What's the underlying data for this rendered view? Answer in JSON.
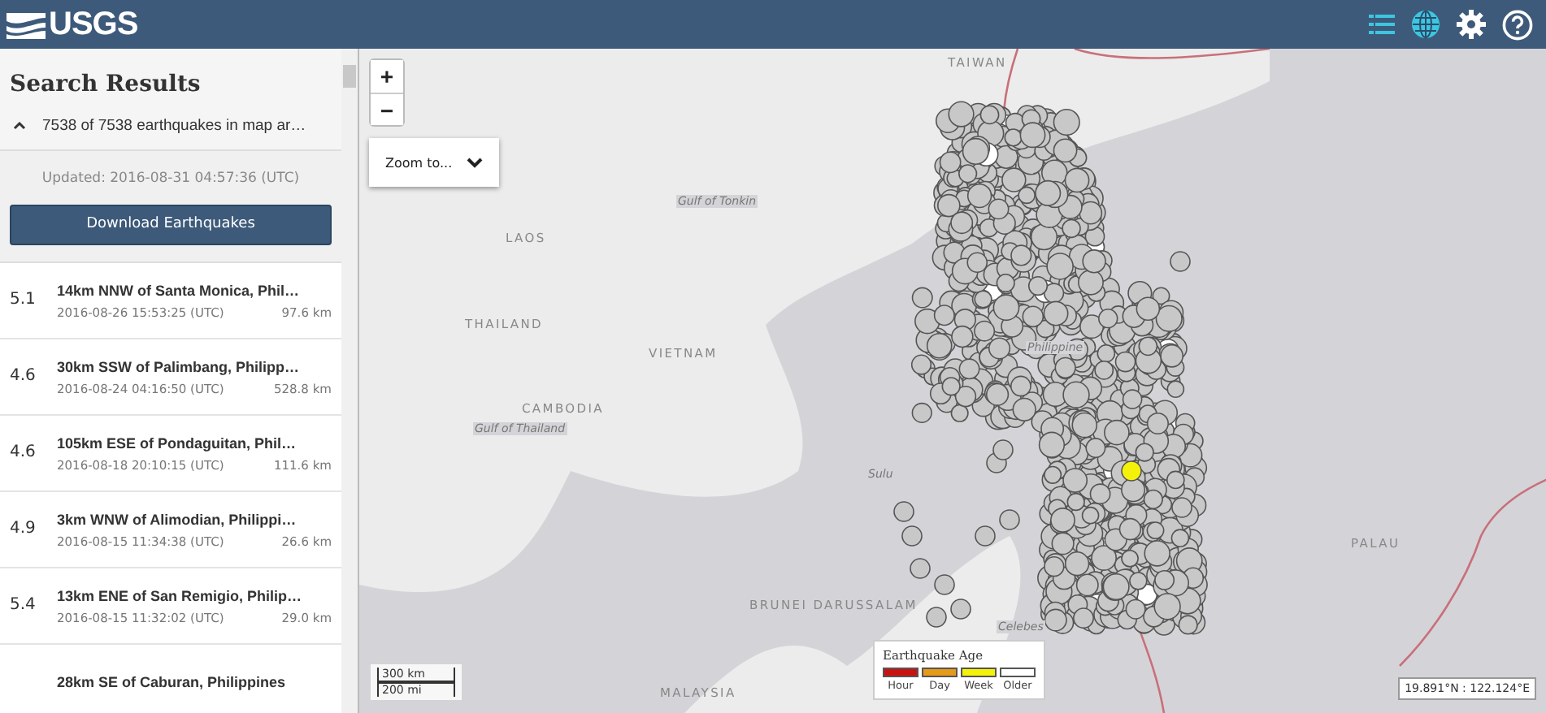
{
  "header": {
    "logo": "USGS"
  },
  "sidebar": {
    "title": "Search Results",
    "summary": "7538 of 7538 earthquakes in map ar…",
    "expanded": true,
    "updated": "Updated: 2016-08-31 04:57:36 (UTC)",
    "download_button": "Download Earthquakes"
  },
  "results": [
    {
      "magnitude": "5.1",
      "place": "14km NNW of Santa Monica, Phil…",
      "time": "2016-08-26 15:53:25 (UTC)",
      "depth": "97.6 km"
    },
    {
      "magnitude": "4.6",
      "place": "30km SSW of Palimbang, Philipp…",
      "time": "2016-08-24 04:16:50 (UTC)",
      "depth": "528.8 km"
    },
    {
      "magnitude": "4.6",
      "place": "105km ESE of Pondaguitan, Phil…",
      "time": "2016-08-18 20:10:15 (UTC)",
      "depth": "111.6 km"
    },
    {
      "magnitude": "4.9",
      "place": "3km WNW of Alimodian, Philippi…",
      "time": "2016-08-15 11:34:38 (UTC)",
      "depth": "26.6 km"
    },
    {
      "magnitude": "5.4",
      "place": "13km ENE of San Remigio, Philip…",
      "time": "2016-08-15 11:32:02 (UTC)",
      "depth": "29.0 km"
    },
    {
      "place": "28km SE of Caburan, Philippines"
    }
  ],
  "map": {
    "zoom_in": "+",
    "zoom_out": "−",
    "zoom_to": "Zoom to...",
    "labels": [
      {
        "text": "TAIWAN",
        "kind": "country"
      },
      {
        "text": "LAOS",
        "kind": "country"
      },
      {
        "text": "Gulf of Tonkin",
        "kind": "water"
      },
      {
        "text": "THAILAND",
        "kind": "country"
      },
      {
        "text": "VIETNAM",
        "kind": "country"
      },
      {
        "text": "CAMBODIA",
        "kind": "country"
      },
      {
        "text": "Gulf of Thailand",
        "kind": "water"
      },
      {
        "text": "Philippine",
        "kind": "water"
      },
      {
        "text": "Sulu",
        "kind": "water"
      },
      {
        "text": "BRUNEI DARUSSALAM",
        "kind": "country"
      },
      {
        "text": "Celebes",
        "kind": "water"
      },
      {
        "text": "MALAYSIA",
        "kind": "country"
      },
      {
        "text": "PALAU",
        "kind": "country"
      }
    ],
    "scale": [
      "300 km",
      "200 mi"
    ],
    "legend": {
      "title": "Earthquake Age",
      "items": [
        {
          "label": "Hour",
          "color": "#cc1111"
        },
        {
          "label": "Day",
          "color": "#e69a1a"
        },
        {
          "label": "Week",
          "color": "#f5f20a"
        },
        {
          "label": "Older",
          "color": "#ffffff"
        }
      ]
    },
    "coordinates": "19.891°N : 122.124°E"
  }
}
